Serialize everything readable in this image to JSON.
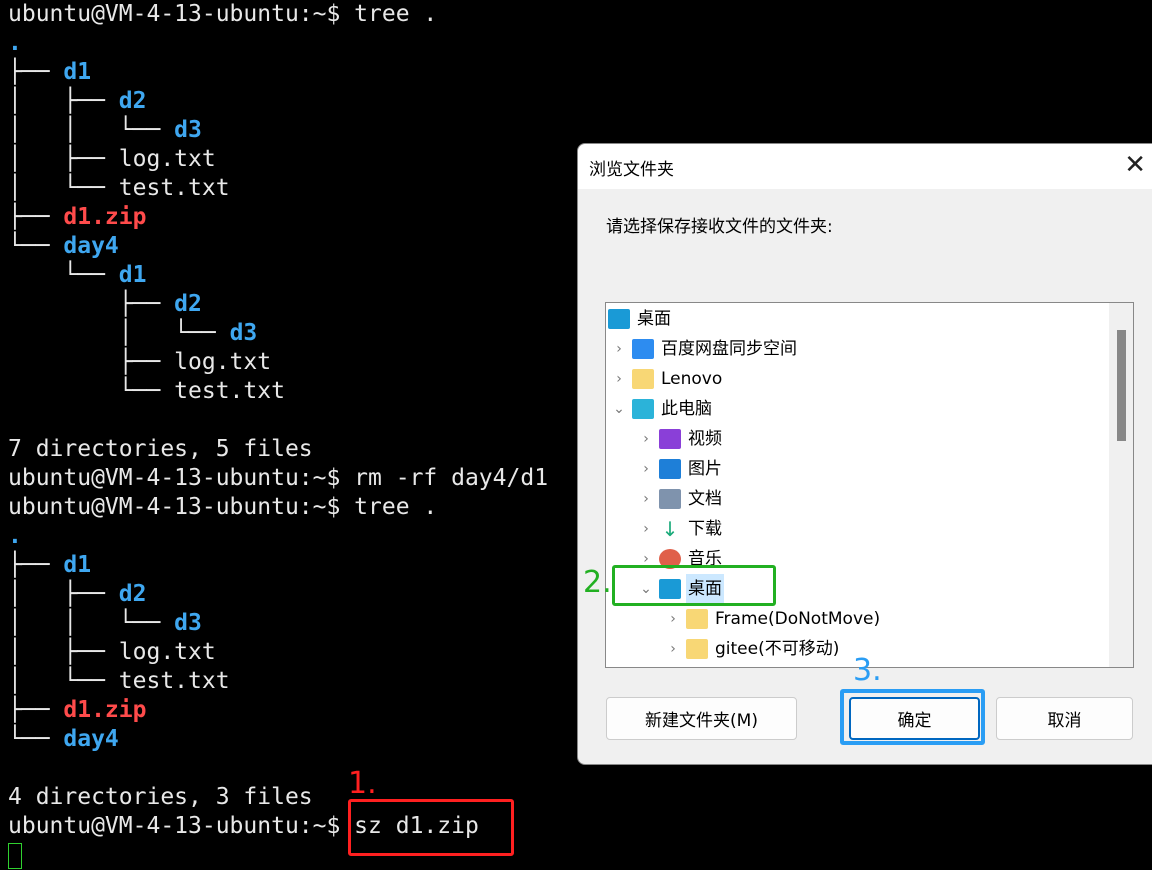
{
  "terminal": {
    "lines": [
      [
        [
          "ubuntu@VM-4-13-ubuntu:~$ tree .",
          ""
        ]
      ],
      [
        [
          ".",
          "dir"
        ]
      ],
      [
        [
          "├── ",
          ""
        ],
        [
          "d1",
          "dir"
        ]
      ],
      [
        [
          "│   ├── ",
          ""
        ],
        [
          "d2",
          "dir"
        ]
      ],
      [
        [
          "│   │   └── ",
          ""
        ],
        [
          "d3",
          "dir"
        ]
      ],
      [
        [
          "│   ├── log.txt",
          ""
        ]
      ],
      [
        [
          "│   └── test.txt",
          ""
        ]
      ],
      [
        [
          "├── ",
          ""
        ],
        [
          "d1.zip",
          "zip"
        ]
      ],
      [
        [
          "└── ",
          ""
        ],
        [
          "day4",
          "dir"
        ]
      ],
      [
        [
          "    └── ",
          ""
        ],
        [
          "d1",
          "dir"
        ]
      ],
      [
        [
          "        ├── ",
          ""
        ],
        [
          "d2",
          "dir"
        ]
      ],
      [
        [
          "        │   └── ",
          ""
        ],
        [
          "d3",
          "dir"
        ]
      ],
      [
        [
          "        ├── log.txt",
          ""
        ]
      ],
      [
        [
          "        └── test.txt",
          ""
        ]
      ],
      [],
      [
        [
          "7 directories, 5 files",
          ""
        ]
      ],
      [
        [
          "ubuntu@VM-4-13-ubuntu:~$ rm -rf day4/d1",
          ""
        ]
      ],
      [
        [
          "ubuntu@VM-4-13-ubuntu:~$ tree .",
          ""
        ]
      ],
      [
        [
          ".",
          "dir"
        ]
      ],
      [
        [
          "├── ",
          ""
        ],
        [
          "d1",
          "dir"
        ]
      ],
      [
        [
          "│   ├── ",
          ""
        ],
        [
          "d2",
          "dir"
        ]
      ],
      [
        [
          "│   │   └── ",
          ""
        ],
        [
          "d3",
          "dir"
        ]
      ],
      [
        [
          "│   ├── log.txt",
          ""
        ]
      ],
      [
        [
          "│   └── test.txt",
          ""
        ]
      ],
      [
        [
          "├── ",
          ""
        ],
        [
          "d1.zip",
          "zip"
        ]
      ],
      [
        [
          "└── ",
          ""
        ],
        [
          "day4",
          "dir"
        ]
      ],
      [],
      [
        [
          "4 directories, 3 files",
          ""
        ]
      ],
      [
        [
          "ubuntu@VM-4-13-ubuntu:~$ sz d1.zip",
          ""
        ]
      ]
    ]
  },
  "annotations": {
    "step1": "1.",
    "step2": "2.",
    "step3": "3.",
    "step1_color": "#ff2020",
    "step2_color": "#22b022",
    "step3_color": "#2a9df4"
  },
  "dialog": {
    "title": "浏览文件夹",
    "close": "✕",
    "prompt": "请选择保存接收文件的文件夹:",
    "tree": [
      {
        "label": "桌面",
        "level": 0,
        "chevron": "",
        "icon": "desktop-icon",
        "color": "#1a9ad6"
      },
      {
        "label": "百度网盘同步空间",
        "level": 0,
        "chevron": "›",
        "icon": "baidu-netdisk-icon",
        "color": "#2d8cf0"
      },
      {
        "label": "Lenovo",
        "level": 0,
        "chevron": "›",
        "icon": "folder-icon",
        "color": "#f8d775"
      },
      {
        "label": "此电脑",
        "level": 0,
        "chevron": "⌄",
        "icon": "computer-icon",
        "color": "#2bb3d9"
      },
      {
        "label": "视频",
        "level": 1,
        "chevron": "›",
        "icon": "video-icon",
        "color": "#8a3fd8"
      },
      {
        "label": "图片",
        "level": 1,
        "chevron": "›",
        "icon": "pictures-icon",
        "color": "#1e7fd8"
      },
      {
        "label": "文档",
        "level": 1,
        "chevron": "›",
        "icon": "documents-icon",
        "color": "#7f93ad"
      },
      {
        "label": "下载",
        "level": 1,
        "chevron": "›",
        "icon": "download-icon",
        "color": "#ffffff"
      },
      {
        "label": "音乐",
        "level": 1,
        "chevron": "›",
        "icon": "music-icon",
        "color": "#e0604a"
      },
      {
        "label": "桌面",
        "level": 1,
        "chevron": "⌄",
        "icon": "desktop-icon",
        "color": "#1a9ad6",
        "selected": true
      },
      {
        "label": "Frame(DoNotMove)",
        "level": 2,
        "chevron": "›",
        "icon": "folder-icon",
        "color": "#f8d775"
      },
      {
        "label": "gitee(不可移动)",
        "level": 2,
        "chevron": "›",
        "icon": "folder-icon",
        "color": "#f8d775"
      }
    ],
    "buttons": {
      "new_folder": "新建文件夹(M)",
      "ok": "确定",
      "cancel": "取消"
    }
  }
}
